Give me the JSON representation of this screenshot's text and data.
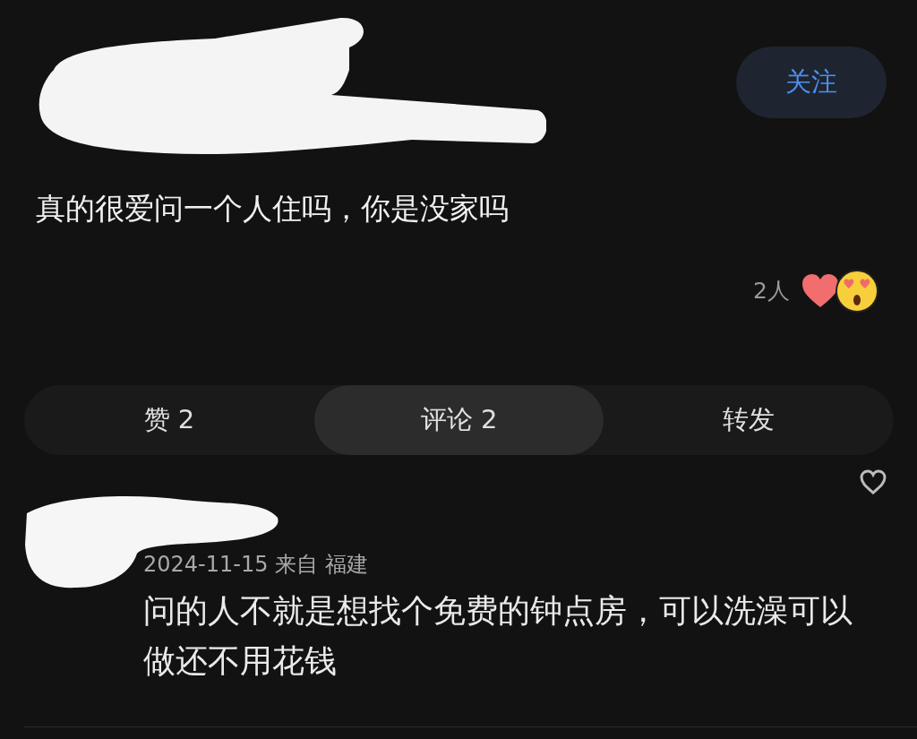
{
  "post": {
    "follow_button": "关注",
    "text": "真的很爱问一个人住吗，你是没家吗",
    "reaction_count": "2人"
  },
  "actions": [
    {
      "label": "赞 2",
      "selected": false
    },
    {
      "label": "评论 2",
      "selected": true
    },
    {
      "label": "转发",
      "selected": false
    }
  ],
  "comments": [
    {
      "meta": "2024-11-15 来自 福建",
      "text": "问的人不就是想找个免费的钟点房，可以洗澡可以做还不用花钱",
      "liked": false
    }
  ]
}
